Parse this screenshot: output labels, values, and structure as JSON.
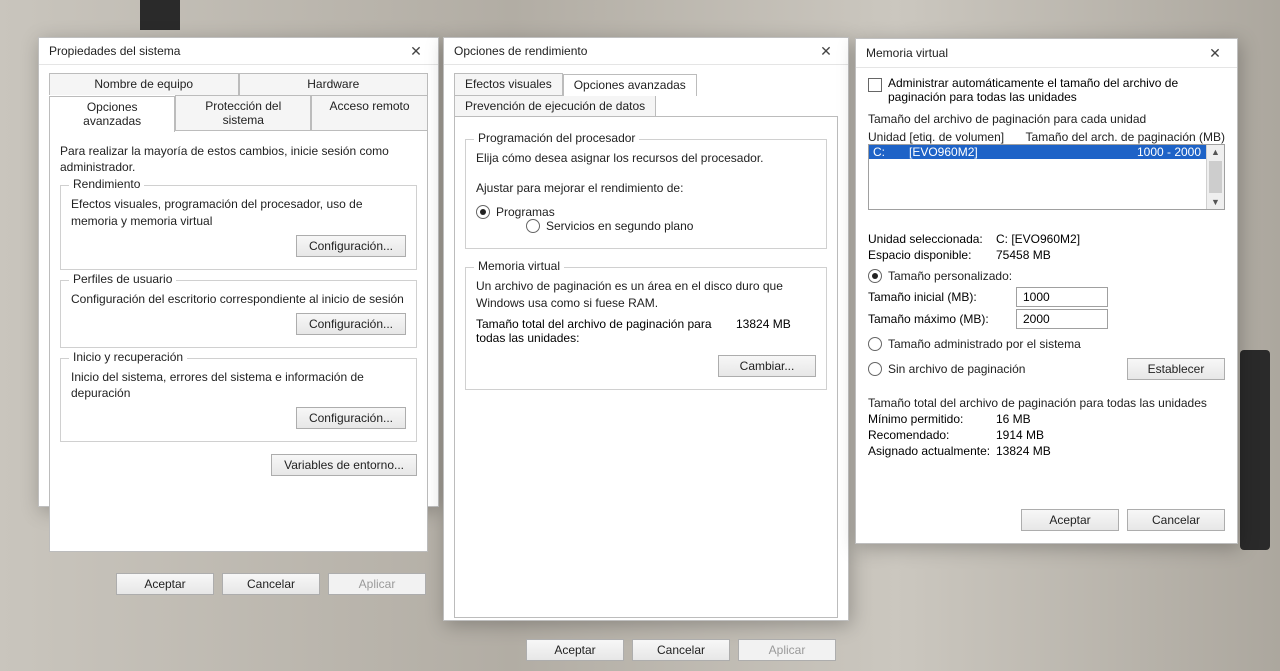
{
  "sysprops": {
    "title": "Propiedades del sistema",
    "tabs_top": [
      "Nombre de equipo",
      "Hardware"
    ],
    "tabs_bottom": [
      "Opciones avanzadas",
      "Protección del sistema",
      "Acceso remoto"
    ],
    "active_tab": "Opciones avanzadas",
    "admin_note": "Para realizar la mayoría de estos cambios, inicie sesión como administrador.",
    "perf": {
      "legend": "Rendimiento",
      "desc": "Efectos visuales, programación del procesador, uso de memoria y memoria virtual",
      "config": "Configuración..."
    },
    "profiles": {
      "legend": "Perfiles de usuario",
      "desc": "Configuración del escritorio correspondiente al inicio de sesión",
      "config": "Configuración..."
    },
    "startup": {
      "legend": "Inicio y recuperación",
      "desc": "Inicio del sistema, errores del sistema e información de depuración",
      "config": "Configuración..."
    },
    "env_vars": "Variables de entorno...",
    "ok": "Aceptar",
    "cancel": "Cancelar",
    "apply": "Aplicar"
  },
  "perfopts": {
    "title": "Opciones de rendimiento",
    "tabs": [
      "Efectos visuales",
      "Opciones avanzadas",
      "Prevención de ejecución de datos"
    ],
    "active_tab": "Opciones avanzadas",
    "proc": {
      "legend": "Programación del procesador",
      "desc": "Elija cómo desea asignar los recursos del procesador.",
      "adjust": "Ajustar para mejorar el rendimiento de:",
      "opt_programs": "Programas",
      "opt_services": "Servicios en segundo plano"
    },
    "vm": {
      "legend": "Memoria virtual",
      "desc": "Un archivo de paginación es un área en el disco duro que Windows usa como si fuese RAM.",
      "total_label": "Tamaño total del archivo de paginación para todas las unidades:",
      "total_value": "13824 MB",
      "change": "Cambiar..."
    },
    "ok": "Aceptar",
    "cancel": "Cancelar",
    "apply": "Aplicar"
  },
  "vmem": {
    "title": "Memoria virtual",
    "auto_label": "Administrar automáticamente el tamaño del archivo de paginación para todas las unidades",
    "per_drive": "Tamaño del archivo de paginación para cada unidad",
    "col_drive": "Unidad [etiq. de volumen]",
    "col_size": "Tamaño del arch. de paginación (MB)",
    "row_drive": "C:",
    "row_label": "[EVO960M2]",
    "row_size": "1000 - 2000",
    "sel_drive_lbl": "Unidad seleccionada:",
    "sel_drive_val": "C:  [EVO960M2]",
    "space_lbl": "Espacio disponible:",
    "space_val": "75458 MB",
    "custom": "Tamaño personalizado:",
    "initial_lbl": "Tamaño inicial (MB):",
    "initial_val": "1000",
    "max_lbl": "Tamaño máximo (MB):",
    "max_val": "2000",
    "sys_managed": "Tamaño administrado por el sistema",
    "no_page": "Sin archivo de paginación",
    "set": "Establecer",
    "totals_title": "Tamaño total del archivo de paginación para todas las unidades",
    "min_lbl": "Mínimo permitido:",
    "min_val": "16 MB",
    "rec_lbl": "Recomendado:",
    "rec_val": "1914 MB",
    "cur_lbl": "Asignado actualmente:",
    "cur_val": "13824 MB",
    "ok": "Aceptar",
    "cancel": "Cancelar"
  }
}
